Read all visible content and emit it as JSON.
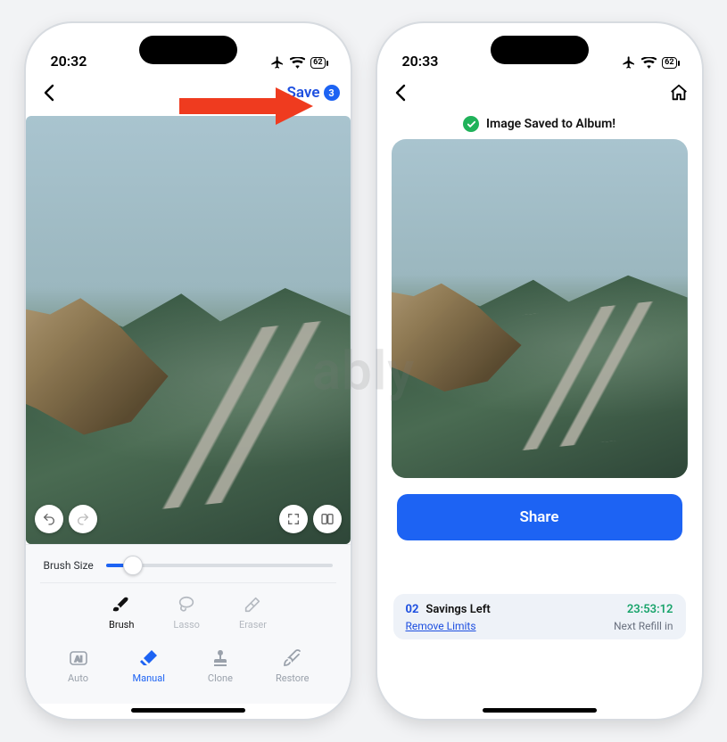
{
  "watermark": "ably",
  "phoneA": {
    "status": {
      "time": "20:32",
      "battery": "62"
    },
    "nav": {
      "save_label": "Save",
      "save_count": "3"
    },
    "slider_label": "Brush Size",
    "tools": {
      "brush": "Brush",
      "lasso": "Lasso",
      "eraser": "Eraser"
    },
    "tabs": {
      "auto": "Auto",
      "manual": "Manual",
      "clone": "Clone",
      "restore": "Restore"
    }
  },
  "phoneB": {
    "status": {
      "time": "20:33",
      "battery": "62"
    },
    "toast": "Image Saved to Album!",
    "share_label": "Share",
    "credits": {
      "count": "02",
      "label": "Savings Left",
      "time": "23:53:12",
      "remove_limits": "Remove Limits",
      "next_refill": "Next Refill in"
    }
  }
}
